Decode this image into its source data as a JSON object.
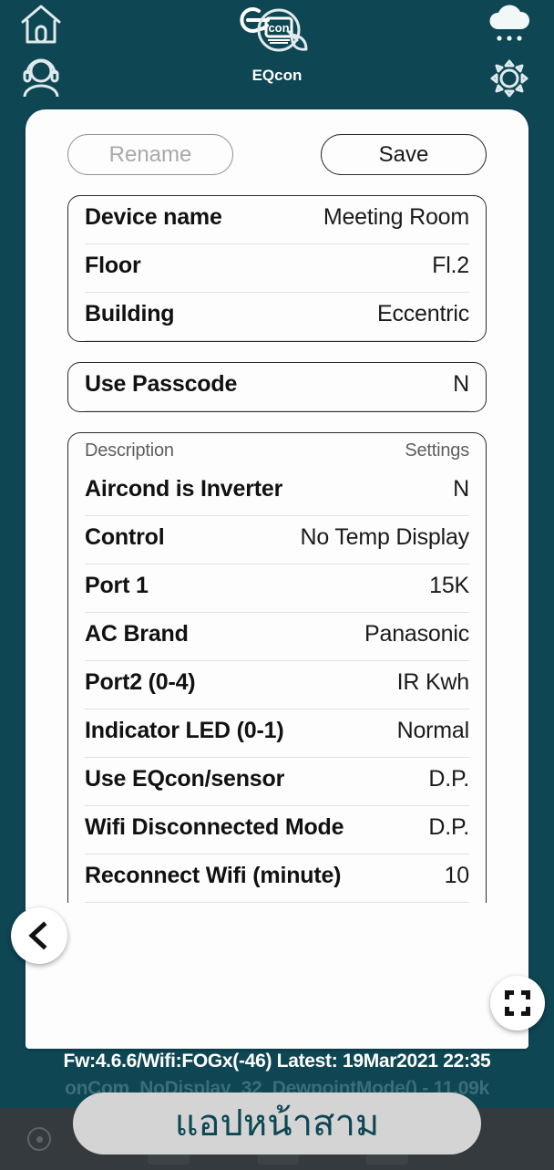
{
  "header": {
    "brand": "EQcon",
    "icons": {
      "home": "home-icon",
      "support": "headset-support-icon",
      "weather": "cloud-rain-icon",
      "settings": "gear-icon"
    }
  },
  "toolbar": {
    "rename_label": "Rename",
    "save_label": "Save"
  },
  "device_card": {
    "rows": [
      {
        "label": "Device name",
        "value": "Meeting Room"
      },
      {
        "label": "Floor",
        "value": "Fl.2"
      },
      {
        "label": "Building",
        "value": "Eccentric"
      }
    ]
  },
  "passcode_card": {
    "rows": [
      {
        "label": "Use Passcode",
        "value": "N"
      }
    ]
  },
  "settings_card": {
    "header": {
      "label": "Description",
      "value": "Settings"
    },
    "rows": [
      {
        "label": "Aircond is Inverter",
        "value": "N"
      },
      {
        "label": "Control",
        "value": "No Temp Display"
      },
      {
        "label": "Port 1",
        "value": "15K"
      },
      {
        "label": "AC Brand",
        "value": "Panasonic"
      },
      {
        "label": "Port2 (0-4)",
        "value": "IR Kwh"
      },
      {
        "label": "Indicator LED (0-1)",
        "value": "Normal"
      },
      {
        "label": "Use EQcon/sensor",
        "value": "D.P."
      },
      {
        "label": "Wifi Disconnected Mode",
        "value": "D.P."
      },
      {
        "label": "Reconnect Wifi (minute)",
        "value": "10"
      }
    ]
  },
  "fab": {
    "back": "back-chevron-icon",
    "compress": "compress-arrows-icon"
  },
  "status": {
    "line1": "Fw:4.6.6/Wifi:FOGx(-46) Latest: 19Mar2021 22:35",
    "line2": "onCom_NoDisplay_32_DewpointMode() - 11.09k"
  },
  "toast": {
    "text": "แอปหน้าสาม"
  },
  "colors": {
    "background": "#0e4653",
    "panel": "#fdfdfd",
    "navbar": "#343a3d",
    "toast_bg": "#d4d4d4",
    "toast_text": "#0e4653",
    "status_line1": "#ffffff",
    "status_line2": "#3c6d78",
    "disabled_text": "#a9a9a9"
  }
}
